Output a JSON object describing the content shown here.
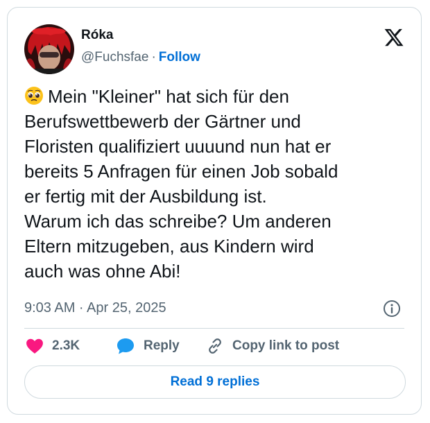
{
  "author": {
    "display_name": "Róka",
    "handle": "@Fuchsfae",
    "separator": "·",
    "follow_label": "Follow"
  },
  "tweet": {
    "emoji": "pleading-face-emoji",
    "lines": [
      "Mein \"Kleiner\" hat sich für den",
      "Berufswettbewerb der Gärtner und",
      "Floristen qualifiziert uuuund nun hat er",
      "bereits 5 Anfragen für einen Job sobald",
      "er fertig mit der Ausbildung ist.",
      "Warum ich das schreibe? Um anderen",
      "Eltern mitzugeben, aus Kindern wird",
      "auch was ohne Abi!"
    ],
    "timestamp": "9:03 AM · Apr 25, 2025"
  },
  "actions": {
    "like_count": "2.3K",
    "reply_label": "Reply",
    "copy_link_label": "Copy link to post"
  },
  "replies_button_label": "Read 9 replies",
  "icons": {
    "brand": "x-logo-icon",
    "info": "info-icon",
    "like": "heart-icon",
    "reply": "reply-bubble-icon",
    "copy": "link-icon"
  },
  "colors": {
    "text": "#0f1419",
    "secondary": "#536471",
    "link": "#006fd6",
    "like": "#f91880",
    "reply": "#1d9bf0",
    "border": "#cfd9de"
  }
}
